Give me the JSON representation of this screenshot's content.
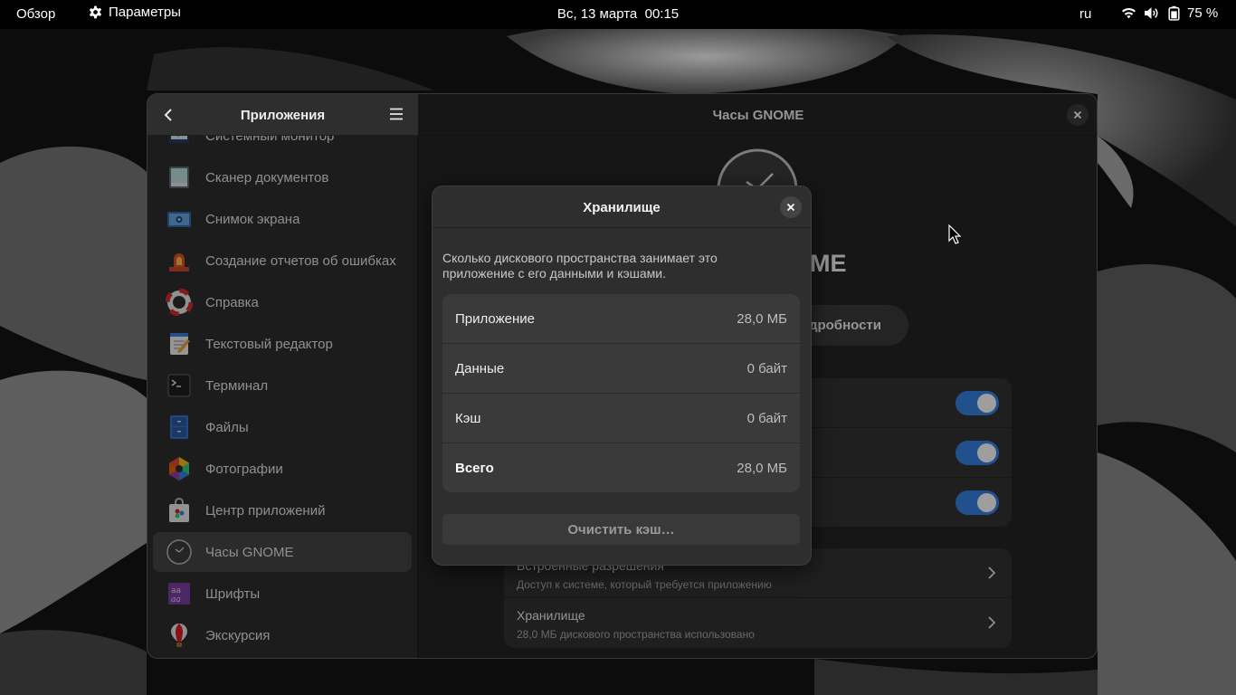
{
  "topbar": {
    "overview": "Обзор",
    "app_menu": "Параметры",
    "clock": "Вс, 13 марта  00:15",
    "language": "ru",
    "battery_percent": "75 %",
    "icons": [
      "wifi-icon",
      "volume-icon",
      "battery-icon"
    ]
  },
  "sidebar": {
    "title": "Приложения",
    "items": [
      {
        "label": "Системный монитор",
        "icon": "system-monitor-icon"
      },
      {
        "label": "Сканер документов",
        "icon": "document-scanner-icon"
      },
      {
        "label": "Снимок экрана",
        "icon": "screenshot-icon"
      },
      {
        "label": "Создание отчетов об ошибках",
        "icon": "bug-report-icon"
      },
      {
        "label": "Справка",
        "icon": "help-icon"
      },
      {
        "label": "Текстовый редактор",
        "icon": "text-editor-icon"
      },
      {
        "label": "Терминал",
        "icon": "terminal-icon"
      },
      {
        "label": "Файлы",
        "icon": "files-icon"
      },
      {
        "label": "Фотографии",
        "icon": "photos-icon"
      },
      {
        "label": "Центр приложений",
        "icon": "software-center-icon"
      },
      {
        "label": "Часы GNOME",
        "icon": "clock-icon",
        "selected": true
      },
      {
        "label": "Шрифты",
        "icon": "fonts-icon"
      },
      {
        "label": "Экскурсия",
        "icon": "tour-icon"
      }
    ]
  },
  "content": {
    "title": "Часы GNOME",
    "app_name_visible": "ME",
    "details_button_visible": "дробности",
    "toggles": [
      true,
      true,
      true
    ],
    "links": [
      {
        "title": "Встроенные разрешения",
        "subtitle": "Доступ к системе, который требуется приложению"
      },
      {
        "title": "Хранилище",
        "subtitle": "28,0 МБ дискового пространства использовано"
      }
    ]
  },
  "dialog": {
    "title": "Хранилище",
    "description": "Сколько дискового пространства занимает это приложение с его данными и кэшами.",
    "rows": [
      {
        "label": "Приложение",
        "value": "28,0 МБ"
      },
      {
        "label": "Данные",
        "value": "0 байт"
      },
      {
        "label": "Кэш",
        "value": "0 байт"
      },
      {
        "label": "Всего",
        "value": "28,0 МБ"
      }
    ],
    "clear_cache": "Очистить кэш…"
  },
  "colors": {
    "accent": "#3584e4",
    "window_bg": "#242424",
    "sidebar_bg": "#2e2e2e",
    "selected_row": "#464646"
  }
}
